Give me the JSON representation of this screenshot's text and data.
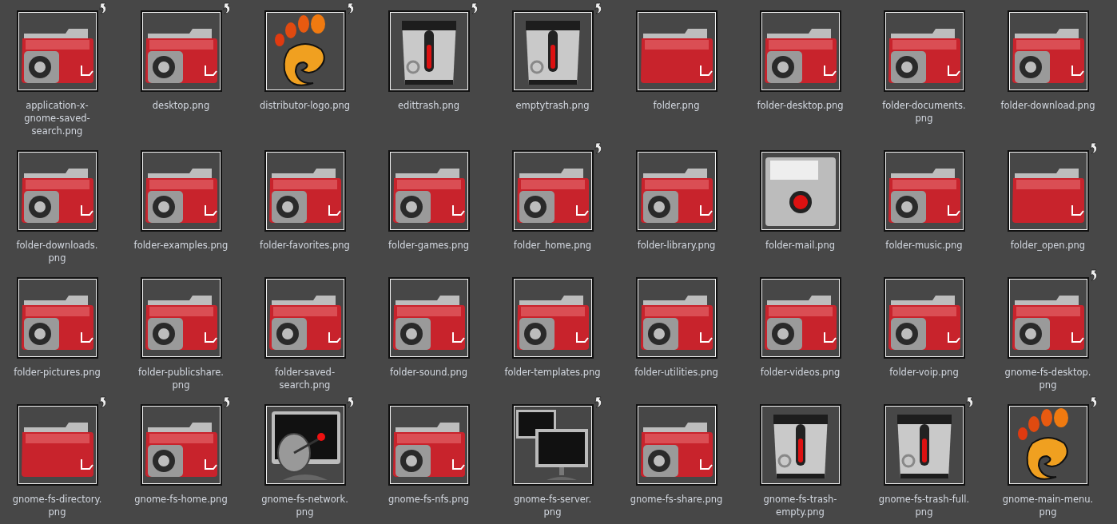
{
  "files": [
    {
      "lines": [
        "application-x-",
        "gnome-saved-",
        "search.png"
      ],
      "kind": "folder-emblem",
      "link": true
    },
    {
      "lines": [
        "desktop.png"
      ],
      "kind": "folder-emblem",
      "link": true
    },
    {
      "lines": [
        "distributor-logo.png"
      ],
      "kind": "foot",
      "link": true
    },
    {
      "lines": [
        "edittrash.png"
      ],
      "kind": "trash",
      "link": true
    },
    {
      "lines": [
        "emptytrash.png"
      ],
      "kind": "trash",
      "link": true
    },
    {
      "lines": [
        "folder.png"
      ],
      "kind": "folder",
      "link": false
    },
    {
      "lines": [
        "folder-desktop.png"
      ],
      "kind": "folder-emblem",
      "link": false
    },
    {
      "lines": [
        "folder-documents.",
        "png"
      ],
      "kind": "folder-emblem",
      "link": false
    },
    {
      "lines": [
        "folder-download.png"
      ],
      "kind": "folder-emblem",
      "link": false
    },
    {
      "lines": [
        "folder-downloads.",
        "png"
      ],
      "kind": "folder-emblem",
      "link": false
    },
    {
      "lines": [
        "folder-examples.png"
      ],
      "kind": "folder-emblem",
      "link": false
    },
    {
      "lines": [
        "folder-favorites.png"
      ],
      "kind": "folder-emblem",
      "link": false
    },
    {
      "lines": [
        "folder-games.png"
      ],
      "kind": "folder-emblem",
      "link": false
    },
    {
      "lines": [
        "folder_home.png"
      ],
      "kind": "folder-emblem",
      "link": true
    },
    {
      "lines": [
        "folder-library.png"
      ],
      "kind": "folder-emblem",
      "link": false
    },
    {
      "lines": [
        "folder-mail.png"
      ],
      "kind": "mail",
      "link": false
    },
    {
      "lines": [
        "folder-music.png"
      ],
      "kind": "folder-emblem",
      "link": false
    },
    {
      "lines": [
        "folder_open.png"
      ],
      "kind": "folder",
      "link": true
    },
    {
      "lines": [
        "folder-pictures.png"
      ],
      "kind": "folder-emblem",
      "link": false
    },
    {
      "lines": [
        "folder-publicshare.",
        "png"
      ],
      "kind": "folder-emblem",
      "link": false
    },
    {
      "lines": [
        "folder-saved-",
        "search.png"
      ],
      "kind": "folder-emblem",
      "link": false
    },
    {
      "lines": [
        "folder-sound.png"
      ],
      "kind": "folder-emblem",
      "link": false
    },
    {
      "lines": [
        "folder-templates.png"
      ],
      "kind": "folder-emblem",
      "link": false
    },
    {
      "lines": [
        "folder-utilities.png"
      ],
      "kind": "folder-emblem",
      "link": false
    },
    {
      "lines": [
        "folder-videos.png"
      ],
      "kind": "folder-emblem",
      "link": false
    },
    {
      "lines": [
        "folder-voip.png"
      ],
      "kind": "folder-emblem",
      "link": false
    },
    {
      "lines": [
        "gnome-fs-desktop.",
        "png"
      ],
      "kind": "folder-emblem",
      "link": true
    },
    {
      "lines": [
        "gnome-fs-directory.",
        "png"
      ],
      "kind": "folder",
      "link": true
    },
    {
      "lines": [
        "gnome-fs-home.png"
      ],
      "kind": "folder-emblem",
      "link": true
    },
    {
      "lines": [
        "gnome-fs-network.",
        "png"
      ],
      "kind": "network",
      "link": true
    },
    {
      "lines": [
        "gnome-fs-nfs.png"
      ],
      "kind": "folder-emblem",
      "link": false
    },
    {
      "lines": [
        "gnome-fs-server.",
        "png"
      ],
      "kind": "server",
      "link": true
    },
    {
      "lines": [
        "gnome-fs-share.png"
      ],
      "kind": "folder-emblem",
      "link": false
    },
    {
      "lines": [
        "gnome-fs-trash-",
        "empty.png"
      ],
      "kind": "trash",
      "link": false
    },
    {
      "lines": [
        "gnome-fs-trash-full.",
        "png"
      ],
      "kind": "trash",
      "link": true
    },
    {
      "lines": [
        "gnome-main-menu.",
        "png"
      ],
      "kind": "foot",
      "link": true
    }
  ]
}
